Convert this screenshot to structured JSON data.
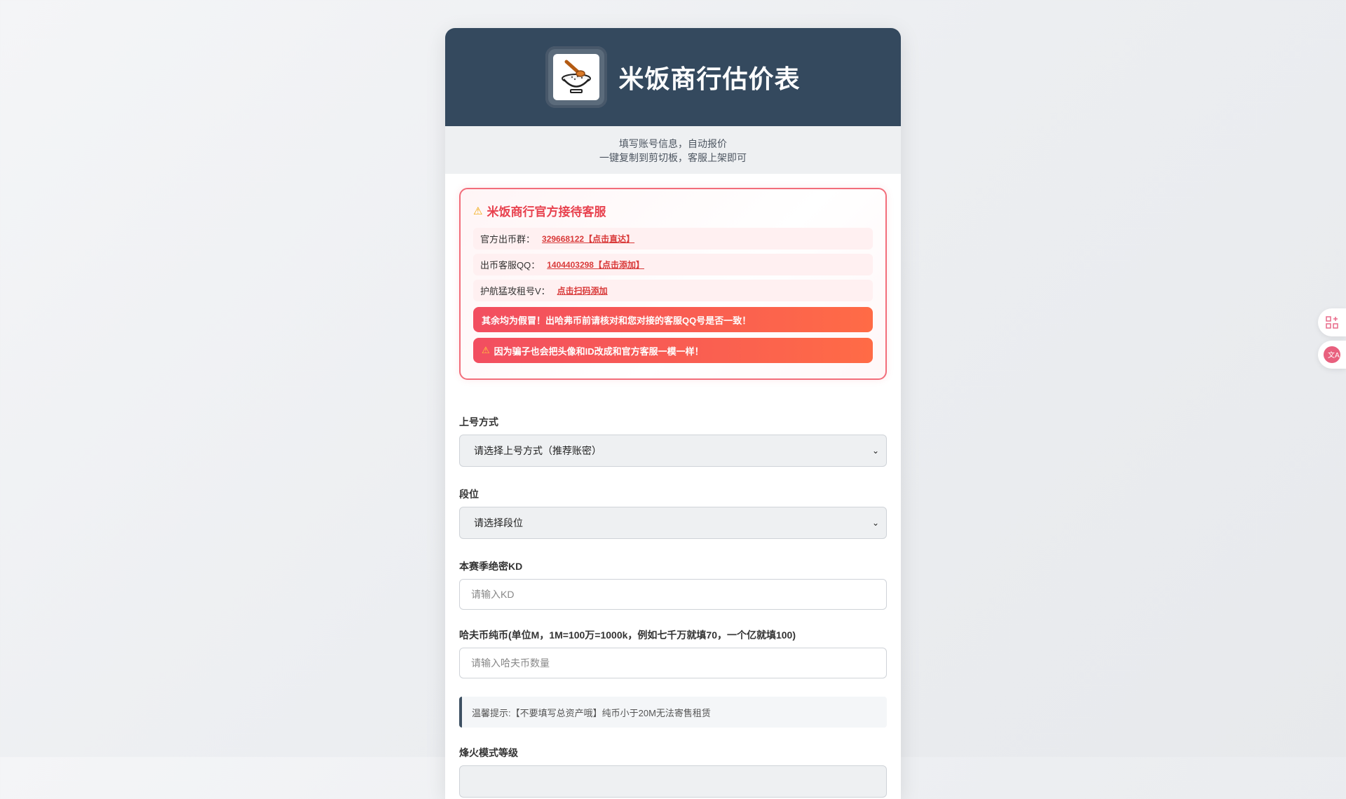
{
  "header": {
    "title": "米饭商行估价表",
    "logo_icon": "rice-bowl-icon"
  },
  "subtitle": {
    "line1": "填写账号信息，自动报价",
    "line2": "一键复制到剪切板，客服上架即可"
  },
  "notice": {
    "title": "米饭商行官方接待客服",
    "rows": [
      {
        "label": "官方出币群：",
        "link": "329668122【点击直达】"
      },
      {
        "label": "出币客服QQ：",
        "link": "1404403298【点击添加】"
      },
      {
        "label": "护航猛攻租号V：",
        "link": "点击扫码添加"
      }
    ],
    "alert1": "其余均为假冒！出哈弗币前请核对和您对接的客服QQ号是否一致！",
    "alert2": "因为骗子也会把头像和ID改成和官方客服一模一样！"
  },
  "form": {
    "login_method": {
      "label": "上号方式",
      "value": "请选择上号方式（推荐账密）"
    },
    "rank": {
      "label": "段位",
      "value": "请选择段位"
    },
    "kd": {
      "label": "本赛季绝密KD",
      "placeholder": "请输入KD"
    },
    "coins": {
      "label": "哈夫币纯币(单位M，1M=100万=1000k，例如七千万就填70，一个亿就填100)",
      "placeholder": "请输入哈夫币数量"
    },
    "tip": "温馨提示:【不要填写总资产哦】纯币小于20M无法寄售租赁",
    "beacon": {
      "label": "烽火模式等级"
    }
  },
  "colors": {
    "header_bg": "#34495e",
    "accent_red": "#f24e60",
    "accent_orange": "#ff6b46"
  }
}
